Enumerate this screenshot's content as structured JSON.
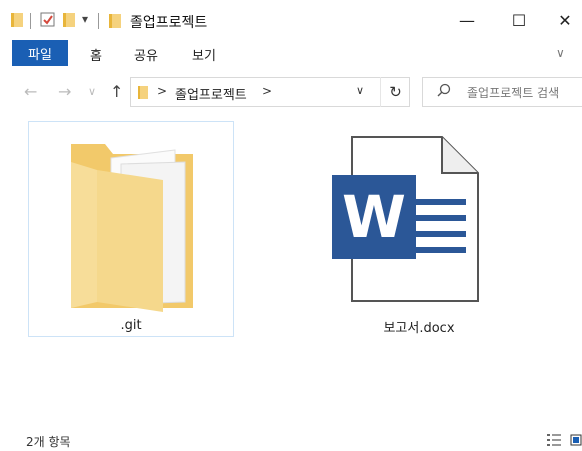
{
  "window": {
    "title": "졸업프로젝트",
    "minimize_symbol": "—",
    "maximize_symbol": "☐",
    "close_symbol": "✕",
    "qa_dropdown_symbol": "▾"
  },
  "ribbon": {
    "tabs": [
      {
        "label": "파일",
        "active": true
      },
      {
        "label": "홈",
        "active": false
      },
      {
        "label": "공유",
        "active": false
      },
      {
        "label": "보기",
        "active": false
      }
    ],
    "expand_symbol": "∨"
  },
  "navigation": {
    "back_symbol": "←",
    "forward_symbol": "→",
    "recent_symbol": "∨",
    "up_symbol": "↑",
    "address": {
      "path": "졸업프로젝트",
      "arrow": ">",
      "dropdown": "∨"
    },
    "refresh_symbol": "↻",
    "search": {
      "icon": "search-icon",
      "placeholder": "졸업프로젝트 검색"
    }
  },
  "files": [
    {
      "name": ".git",
      "type": "folder",
      "selected": true
    },
    {
      "name": "보고서.docx",
      "type": "word-document",
      "selected": false
    }
  ],
  "status": {
    "item_count": "2개 항목"
  },
  "colors": {
    "accent": "#1a5fb4",
    "folder": "#f5d27e",
    "word_blue": "#2b5797"
  }
}
